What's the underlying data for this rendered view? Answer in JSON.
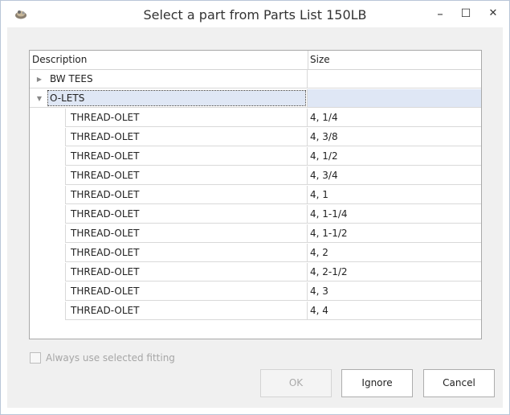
{
  "window": {
    "title": "Select a part from Parts List 150LB",
    "minimize_glyph": "–",
    "maximize_glyph": "☐",
    "close_glyph": "✕"
  },
  "grid": {
    "columns": [
      "Description",
      "Size"
    ],
    "groups": [
      {
        "label": "BW TEES",
        "expanded": false,
        "expander": "▶"
      },
      {
        "label": "O-LETS",
        "expanded": true,
        "expander": "▼"
      }
    ],
    "rows": [
      {
        "description": "THREAD-OLET",
        "size": "4, 1/4"
      },
      {
        "description": "THREAD-OLET",
        "size": "4, 3/8"
      },
      {
        "description": "THREAD-OLET",
        "size": "4, 1/2"
      },
      {
        "description": "THREAD-OLET",
        "size": "4, 3/4"
      },
      {
        "description": "THREAD-OLET",
        "size": "4, 1"
      },
      {
        "description": "THREAD-OLET",
        "size": "4, 1-1/4"
      },
      {
        "description": "THREAD-OLET",
        "size": "4, 1-1/2"
      },
      {
        "description": "THREAD-OLET",
        "size": "4, 2"
      },
      {
        "description": "THREAD-OLET",
        "size": "4, 2-1/2"
      },
      {
        "description": "THREAD-OLET",
        "size": "4, 3"
      },
      {
        "description": "THREAD-OLET",
        "size": "4, 4"
      }
    ]
  },
  "always_use": {
    "label": "Always use selected fitting",
    "checked": false,
    "enabled": false
  },
  "buttons": {
    "ok": "OK",
    "ignore": "Ignore",
    "cancel": "Cancel"
  }
}
